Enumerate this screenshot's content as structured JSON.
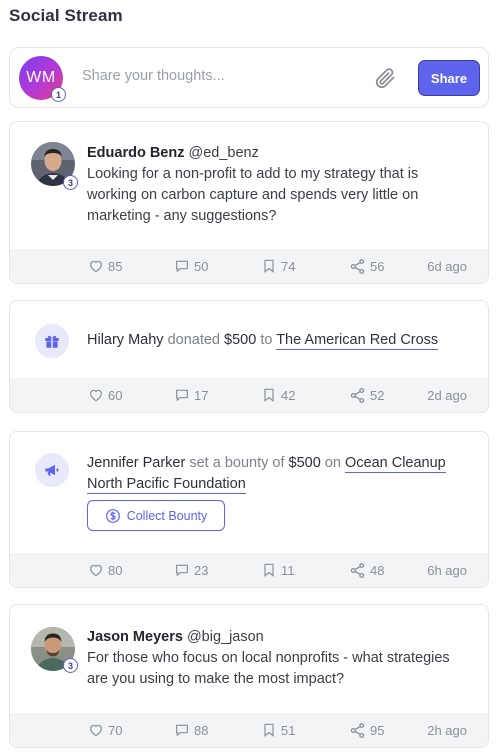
{
  "header": {
    "title": "Social Stream"
  },
  "composer": {
    "avatar_initials": "WM",
    "avatar_badge": "1",
    "placeholder": "Share your thoughts...",
    "attach_icon": "paperclip-icon",
    "share_label": "Share"
  },
  "posts": [
    {
      "type": "post",
      "author": "Eduardo Benz",
      "handle": "@ed_benz",
      "badge": "3",
      "line1": "Looking for a non-profit to add to my strategy that is",
      "line2": "working on carbon capture and spends very little on",
      "line3": "marketing - any suggestions?",
      "stats": {
        "likes": "85",
        "comments": "50",
        "bookmarks": "74",
        "shares": "56",
        "time": "6d ago"
      }
    },
    {
      "type": "donation",
      "icon": "gift-icon",
      "author": "Hilary Mahy",
      "verb": "donated",
      "amount": "$500",
      "to_word": "to",
      "target": "The American Red Cross",
      "stats": {
        "likes": "60",
        "comments": "17",
        "bookmarks": "42",
        "shares": "52",
        "time": "2d ago"
      }
    },
    {
      "type": "bounty",
      "icon": "megaphone-icon",
      "author": "Jennifer Parker",
      "verb": "set a bounty of",
      "amount": "$500",
      "on_word": "on",
      "target_line1": "Ocean Cleanup",
      "target_line2": "North Pacific Foundation",
      "button_label": "Collect Bounty",
      "stats": {
        "likes": "80",
        "comments": "23",
        "bookmarks": "11",
        "shares": "48",
        "time": "6h ago"
      }
    },
    {
      "type": "post",
      "author": "Jason Meyers",
      "handle": "@big_jason",
      "badge": "3",
      "line1": "For those who focus on local nonprofits - what strategies",
      "line2": "are you using to make the most impact?",
      "stats": {
        "likes": "70",
        "comments": "88",
        "bookmarks": "51",
        "shares": "95",
        "time": "2h ago"
      }
    }
  ],
  "colors": {
    "accent": "#5e63ec",
    "footer_bg": "#f3f4f6",
    "border": "#e3e5ea"
  }
}
